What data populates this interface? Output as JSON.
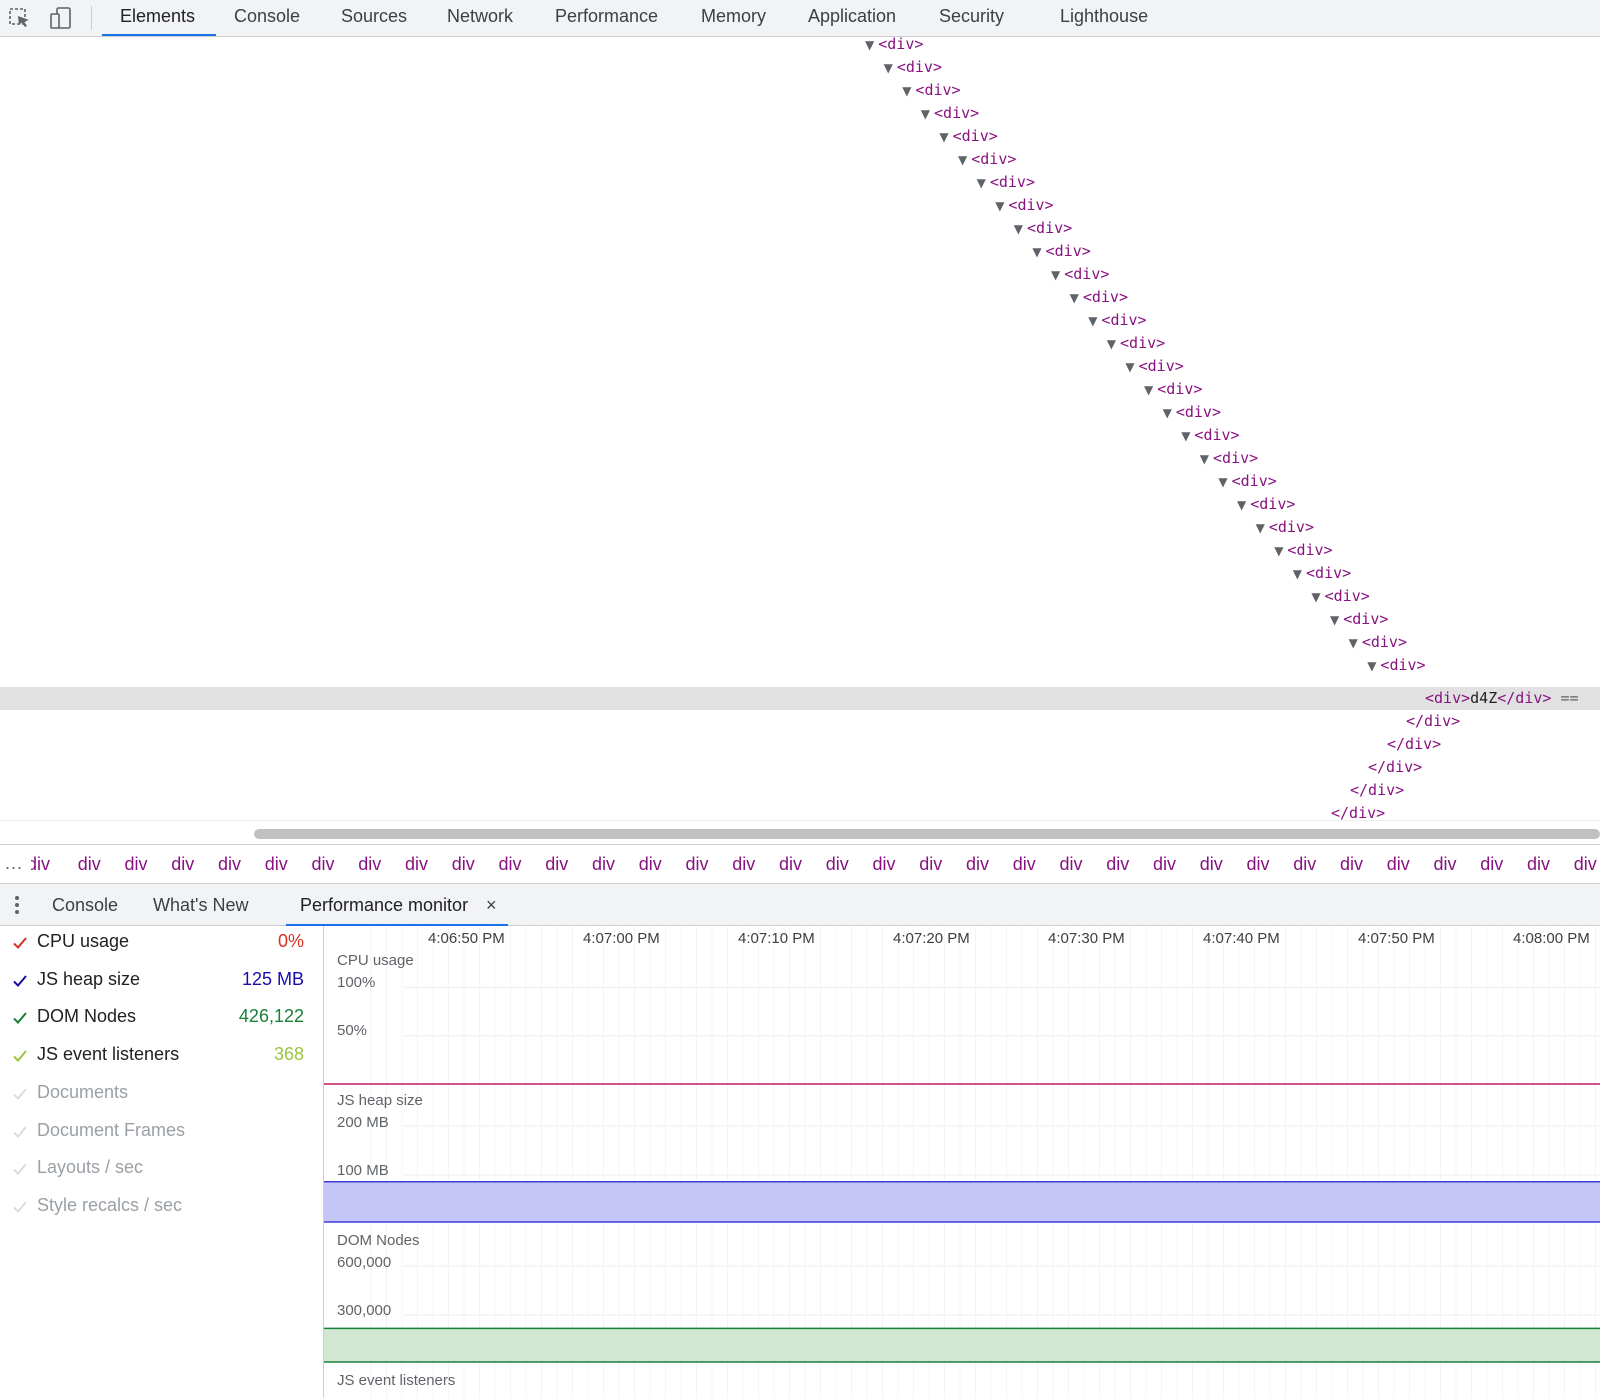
{
  "toolbar": {
    "inspect_icon": "element-picker-icon",
    "device_icon": "device-toolbar-icon"
  },
  "tabs": [
    {
      "label": "Elements",
      "active": true
    },
    {
      "label": "Console",
      "active": false
    },
    {
      "label": "Sources",
      "active": false
    },
    {
      "label": "Network",
      "active": false
    },
    {
      "label": "Performance",
      "active": false
    },
    {
      "label": "Memory",
      "active": false
    },
    {
      "label": "Application",
      "active": false
    },
    {
      "label": "Security",
      "active": false
    },
    {
      "label": "Lighthouse",
      "active": false
    }
  ],
  "tree": {
    "open_tag": "<div>",
    "close_tag": "</div>",
    "triangle": "▼",
    "selected_node": {
      "open": "<div>",
      "text": "d4Z",
      "close": "</div>",
      "ref": " == "
    }
  },
  "breadcrumbs": {
    "more": "...",
    "first": "div",
    "item": "div"
  },
  "drawer": {
    "tabs": [
      {
        "label": "Console",
        "active": false
      },
      {
        "label": "What's New",
        "active": false
      },
      {
        "label": "Performance monitor",
        "active": true
      }
    ],
    "close_glyph": "×"
  },
  "metrics": [
    {
      "label": "CPU usage",
      "value": "0%",
      "enabled": true,
      "color": "#d93025"
    },
    {
      "label": "JS heap size",
      "value": "125 MB",
      "enabled": true,
      "color": "#1a0dab"
    },
    {
      "label": "DOM Nodes",
      "value": "426,122",
      "enabled": true,
      "color": "#188038"
    },
    {
      "label": "JS event listeners",
      "value": "368",
      "enabled": true,
      "color": "#9bc53d"
    },
    {
      "label": "Documents",
      "value": "",
      "enabled": false,
      "color": "#dadce0"
    },
    {
      "label": "Document Frames",
      "value": "",
      "enabled": false,
      "color": "#dadce0"
    },
    {
      "label": "Layouts / sec",
      "value": "",
      "enabled": false,
      "color": "#dadce0"
    },
    {
      "label": "Style recalcs / sec",
      "value": "",
      "enabled": false,
      "color": "#dadce0"
    }
  ],
  "timeline": {
    "times": [
      "4:06:50 PM",
      "4:07:00 PM",
      "4:07:10 PM",
      "4:07:20 PM",
      "4:07:30 PM",
      "4:07:40 PM",
      "4:07:50 PM",
      "4:08:00 PM"
    ]
  },
  "charts": {
    "cpu": {
      "title": "CPU usage",
      "ticks": [
        "100%",
        "50%"
      ],
      "current": 0,
      "max": 100,
      "color": "#c2185b"
    },
    "heap": {
      "title": "JS heap size",
      "ticks": [
        "200 MB",
        "100 MB"
      ],
      "current_mb": 125,
      "max_mb": 200,
      "color": "#3c3cd8",
      "fill": "#c5c5f7"
    },
    "dom": {
      "title": "DOM Nodes",
      "ticks": [
        "600,000",
        "300,000"
      ],
      "current": 426122,
      "max": 600000,
      "color": "#188038",
      "fill": "#d2e7d2"
    },
    "listeners": {
      "title": "JS event listeners"
    }
  }
}
